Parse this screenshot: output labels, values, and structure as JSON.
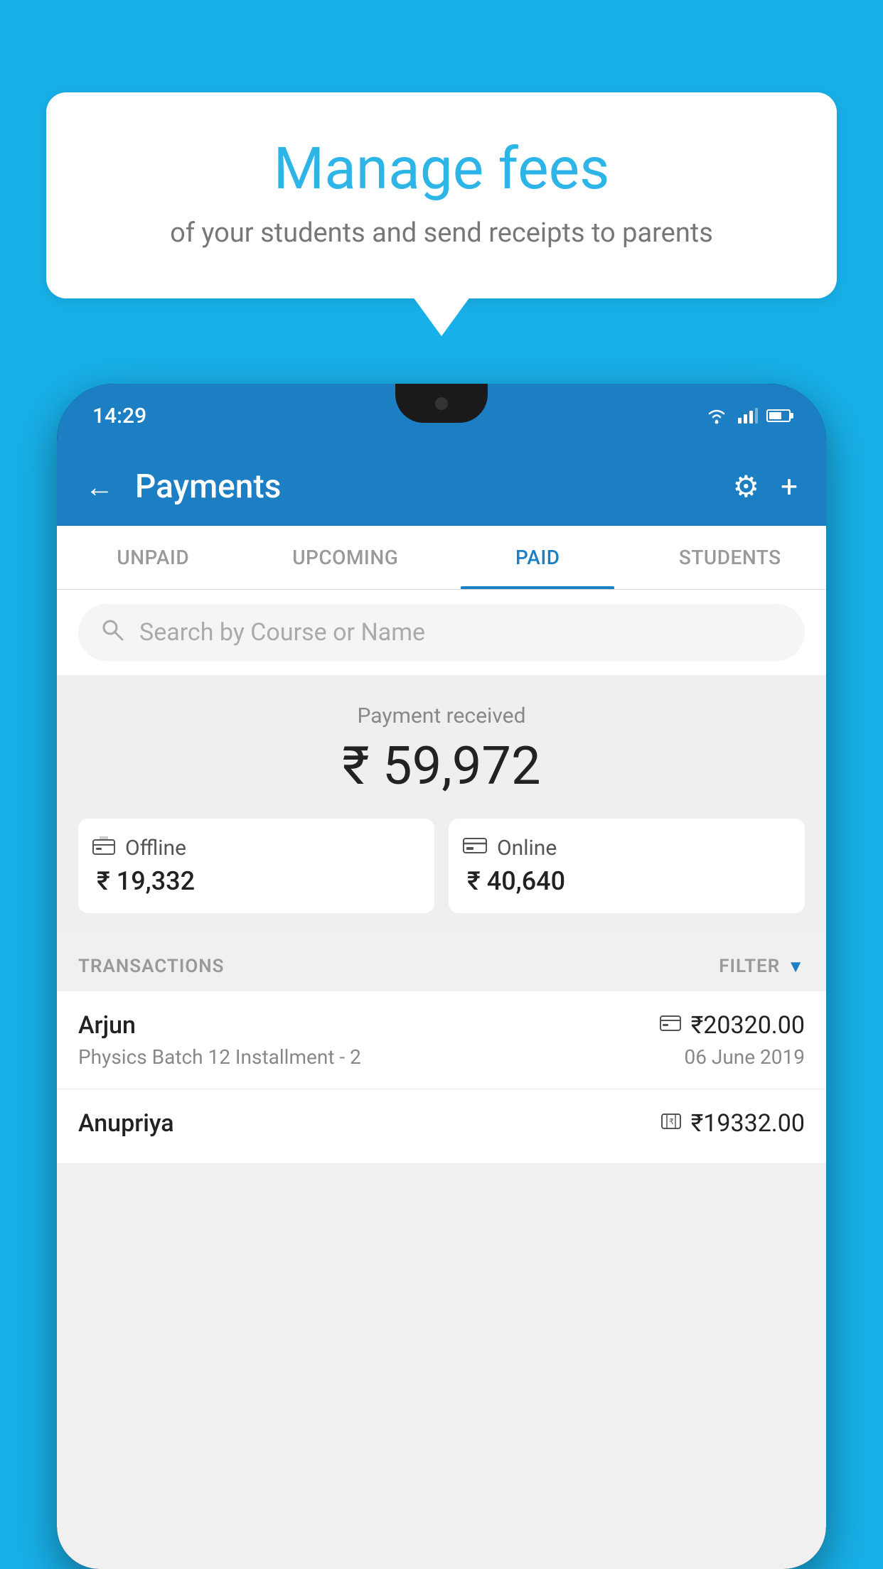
{
  "background_color": "#18b0e8",
  "speech_bubble": {
    "title": "Manage fees",
    "subtitle": "of your students and send receipts to parents"
  },
  "status_bar": {
    "time": "14:29"
  },
  "header": {
    "title": "Payments",
    "back_label": "←",
    "settings_icon": "⚙",
    "add_icon": "+"
  },
  "tabs": [
    {
      "label": "UNPAID",
      "active": false
    },
    {
      "label": "UPCOMING",
      "active": false
    },
    {
      "label": "PAID",
      "active": true
    },
    {
      "label": "STUDENTS",
      "active": false
    }
  ],
  "search": {
    "placeholder": "Search by Course or Name"
  },
  "payment_summary": {
    "received_label": "Payment received",
    "total_amount": "₹ 59,972",
    "offline": {
      "label": "Offline",
      "amount": "₹ 19,332"
    },
    "online": {
      "label": "Online",
      "amount": "₹ 40,640"
    }
  },
  "transactions": {
    "header_label": "TRANSACTIONS",
    "filter_label": "FILTER",
    "rows": [
      {
        "name": "Arjun",
        "description": "Physics Batch 12 Installment - 2",
        "amount": "₹20320.00",
        "date": "06 June 2019",
        "payment_type": "online"
      },
      {
        "name": "Anupriya",
        "description": "",
        "amount": "₹19332.00",
        "date": "",
        "payment_type": "offline"
      }
    ]
  }
}
